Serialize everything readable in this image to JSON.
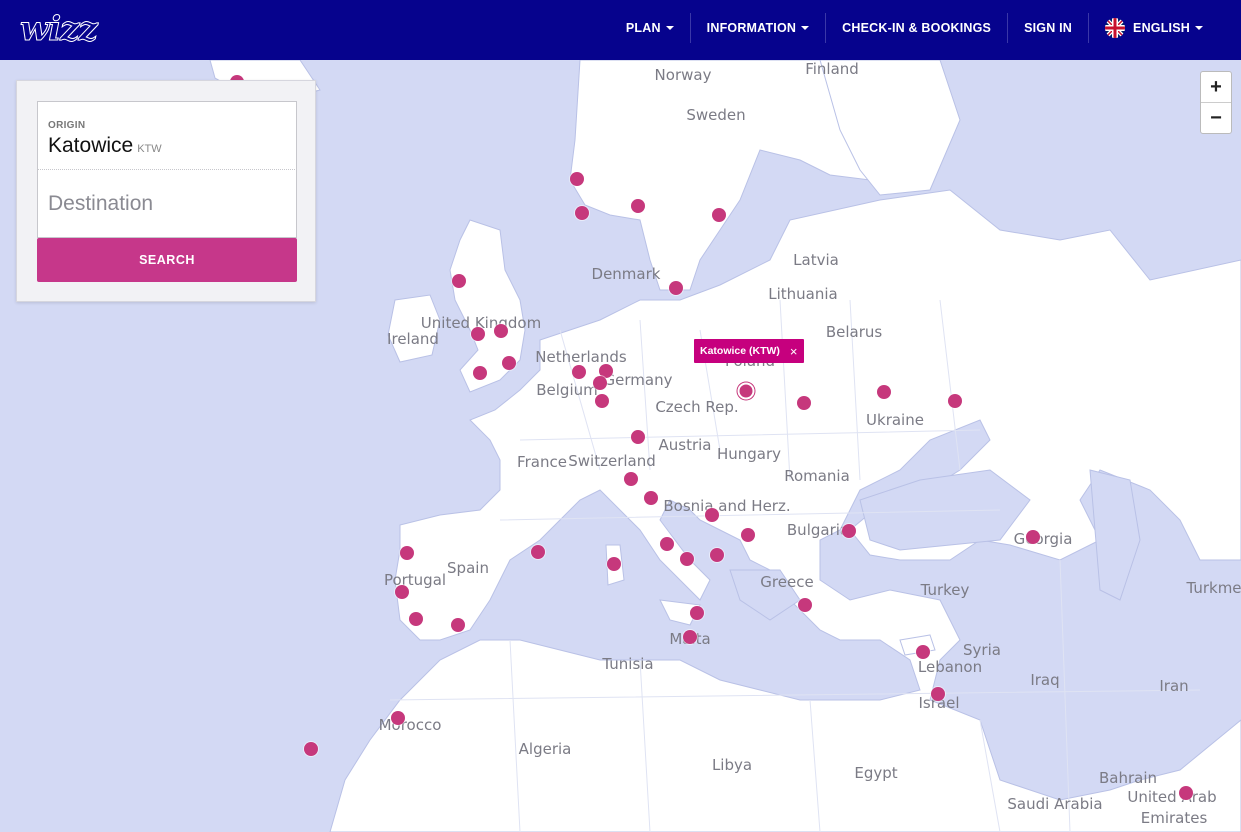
{
  "header": {
    "logo": "wizz",
    "nav": [
      {
        "label": "PLAN",
        "dropdown": true
      },
      {
        "label": "INFORMATION",
        "dropdown": true
      },
      {
        "label": "CHECK-IN & BOOKINGS",
        "dropdown": false
      },
      {
        "label": "SIGN IN",
        "dropdown": false
      },
      {
        "label": "ENGLISH",
        "dropdown": true,
        "icon": "uk-flag-icon"
      }
    ]
  },
  "search": {
    "origin_label": "ORIGIN",
    "origin_city": "Katowice",
    "origin_code": "KTW",
    "destination_placeholder": "Destination",
    "search_button": "SEARCH"
  },
  "map": {
    "popup_label": "Katowice (KTW)",
    "zoom_in": "+",
    "zoom_out": "−",
    "countries": [
      "Norway",
      "Finland",
      "Sweden",
      "Denmark",
      "Latvia",
      "Lithuania",
      "United Kingdom",
      "Ireland",
      "Netherlands",
      "Belarus",
      "Poland",
      "Germany",
      "Belgium",
      "Czech Rep.",
      "Ukraine",
      "Austria",
      "France",
      "Switzerland",
      "Hungary",
      "Romania",
      "Bosnia and Herz.",
      "Bulgaria",
      "Georgia",
      "Spain",
      "Portugal",
      "Greece",
      "Turkey",
      "Turkme",
      "Syria",
      "Lebanon",
      "Iraq",
      "Iran",
      "Malta",
      "Tunisia",
      "Israel",
      "Morocco",
      "Algeria",
      "Libya",
      "Egypt",
      "Bahrain",
      "Saudi Arabia",
      "United Arab",
      "Emirates"
    ]
  },
  "colors": {
    "header_bg": "#06038d",
    "accent": "#c6378a",
    "marker": "#c6387c",
    "sea": "#d3d9f4",
    "land": "#ffffff"
  }
}
